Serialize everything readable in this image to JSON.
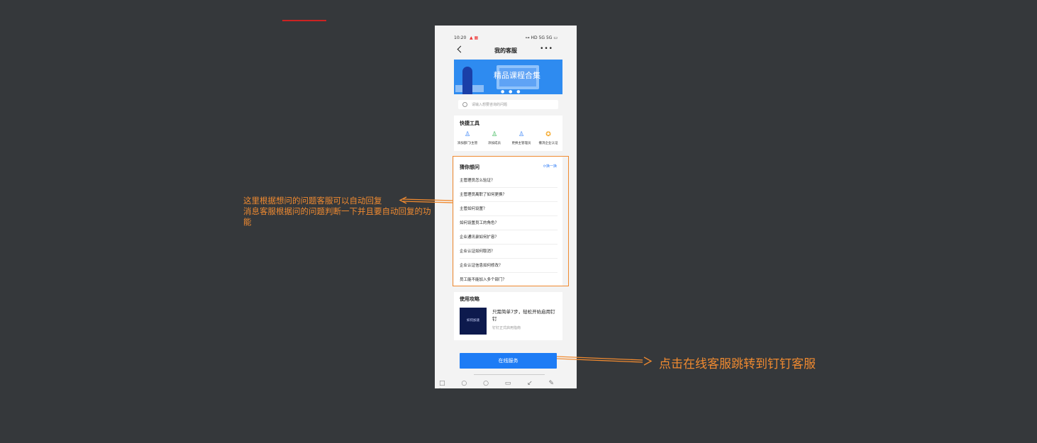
{
  "phone": {
    "status_bar": {
      "time": "10:20",
      "notif": "▲ ▦",
      "right": "⊶ HD 5G 5G ▭"
    },
    "nav": {
      "title": "我的客服",
      "more": "•••"
    },
    "banner": {
      "text": "精品课程合集",
      "dots": "● ● ●"
    },
    "search": {
      "placeholder": "请输入想要咨询的问题"
    },
    "quick_tools": {
      "title": "快捷工具",
      "items": [
        {
          "label": "添加部门/主管",
          "icon": "user-add-icon",
          "color": "#2e7cf6"
        },
        {
          "label": "添加成员",
          "icon": "user-plus-icon",
          "color": "#2bb24c"
        },
        {
          "label": "更换主管理员",
          "icon": "user-switch-icon",
          "color": "#2e7cf6"
        },
        {
          "label": "撤消企业认证",
          "icon": "badge-cancel-icon",
          "color": "#f5a623"
        }
      ]
    },
    "faq": {
      "title": "猜你想问",
      "refresh_label": "换一换",
      "items": [
        "主管理员怎么验证？",
        "主管理员离职了如何更换？",
        "主管如何设置？",
        "如何设置员工的角色？",
        "企业通讯录如何扩容？",
        "企业认证如何取消？",
        "企业认证信息如何修改？",
        "员工能不能加入多个部门？"
      ]
    },
    "guide": {
      "title": "使用攻略",
      "thumb_text": "如何加速",
      "item_title": "只需简单7步，轻松开始启用钉钉",
      "item_sub": "钉钉正式启用指南"
    },
    "online_service_label": "在线服务",
    "bottom_bar": "□ ○ ○ ▭ ↙ ✎ ✂"
  },
  "annotations": {
    "left": "这里根据想问的问题客服可以自动回复\n消息客服根据问的问题判断一下并且要自动回复的功能",
    "right": "点击在线客服跳转到钉钉客服"
  },
  "colors": {
    "background": "#35383b",
    "accent": "#f08a30",
    "primary": "#1e7cf5"
  }
}
